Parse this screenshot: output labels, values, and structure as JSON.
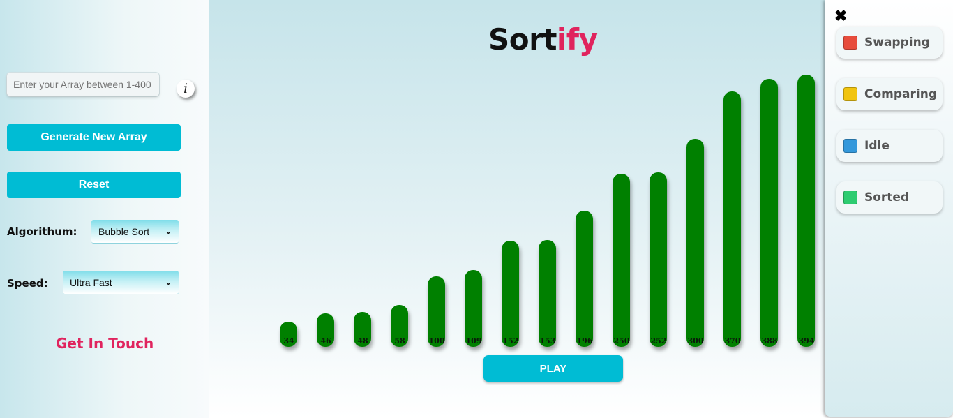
{
  "sidebar": {
    "input_placeholder": "Enter your Array between 1-400",
    "info_label": "i",
    "generate_label": "Generate New Array",
    "reset_label": "Reset",
    "algorithm_label": "Algorithum:",
    "algorithm_value": "Bubble Sort",
    "speed_label": "Speed:",
    "speed_value": "Ultra Fast",
    "contact_label": "Get In Touch"
  },
  "header": {
    "title_main": "Sort",
    "title_accent": "ify"
  },
  "bars": {
    "values": [
      34,
      46,
      48,
      58,
      100,
      109,
      152,
      153,
      196,
      250,
      252,
      300,
      370,
      388,
      394
    ],
    "color": "#008000",
    "max": 400
  },
  "play_label": "PLAY",
  "legend": {
    "close_icon": "close-icon",
    "items": [
      {
        "label": "Swapping",
        "color": "#e74c3c"
      },
      {
        "label": "Comparing",
        "color": "#f1c40f"
      },
      {
        "label": "Idle",
        "color": "#3498db"
      },
      {
        "label": "Sorted",
        "color": "#2ecc71"
      }
    ]
  },
  "colors": {
    "accent": "#00bcd4",
    "brand_pink": "#e0245e"
  }
}
